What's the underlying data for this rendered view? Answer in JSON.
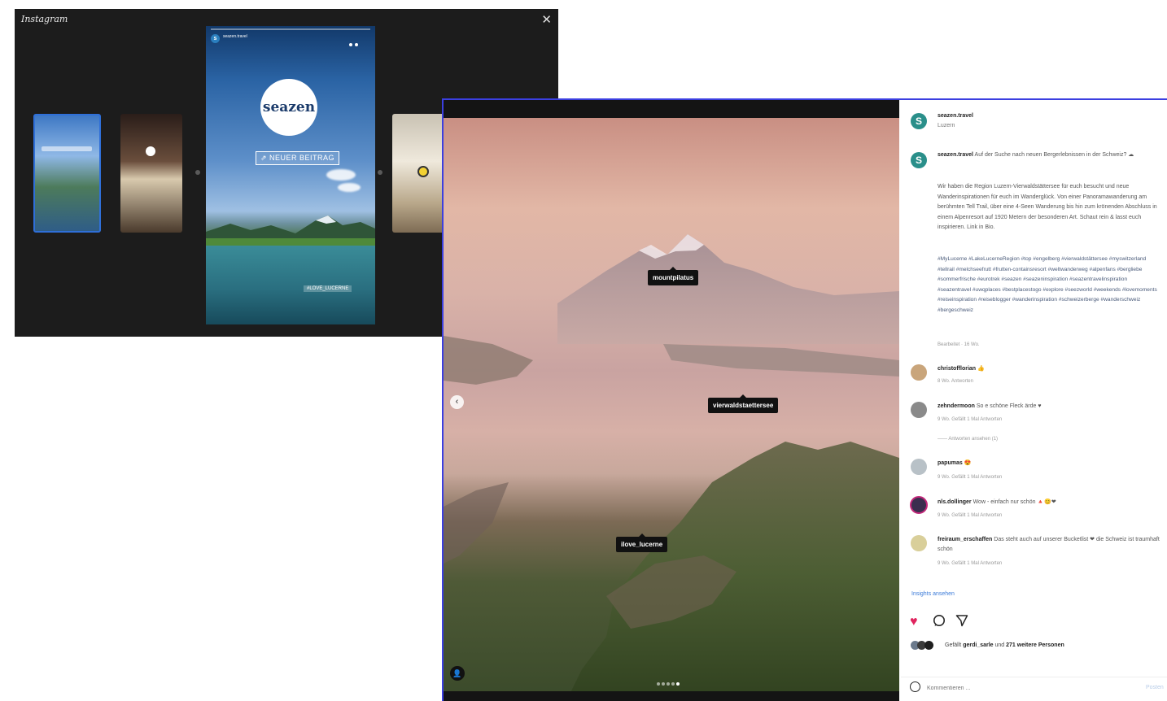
{
  "stories": {
    "logo": "Instagram",
    "close_icon": "✕",
    "thumb2_title": "",
    "main": {
      "badge": "seazen",
      "new_post": "⇗ NEUER BEITRAG",
      "tag": "#LOVE_LUCERNE",
      "username": "seazen.travel",
      "subtitle": ""
    }
  },
  "post": {
    "labels": {
      "pilatus": "mountpilatus",
      "lake": "vierwaldstaettersee",
      "lucerne": "ilove_lucerne"
    },
    "header": {
      "username": "seazen.travel",
      "location": "Luzern",
      "logo": "S"
    },
    "caption": {
      "username": "seazen.travel",
      "lead": "Auf der Suche nach neuen Bergerlebnissen in der Schweiz? ☁",
      "body": "Wir haben die Region Luzern-Vierwaldstättersee für euch besucht und neue Wanderinspirationen für euch im Wanderglück. Von einer Panoramawanderung am berühmten Tell Trail, über eine 4-Seen Wanderung bis hin zum krönenden Abschluss in einem Alpenresort auf 1920 Metern der besonderen Art. Schaut rein & lasst euch inspirieren. Link in Bio.",
      "hashtags": "#MyLucerne #LakeLucerneRegion #top #engelberg #vierwaldstättersee #myswitzerland #tellrail #melchseefrutt #frutten-containsresort #weltwanderweg #alpenfans #bergliebe #sommerfrische #eurotrek #seazen #seazeninspiration #seazentravelinspiration #seazentravel #uwqplaces #bestplacestogo #explore #seezworld #weekends #lovemoments #reiseinspiration #reiseblogger #wanderinspiration #schweizerberge #wanderschweiz #bergeschweiz",
      "meta": "Bearbeitet · 16 Wo."
    },
    "comments": [
      {
        "username": "christofflorian",
        "text": "👍",
        "meta": "8 Wo.   Antworten"
      },
      {
        "username": "zehndermoon",
        "text": "So e schöne Fleck ärde ♥",
        "meta": "9 Wo.   Gefällt 1 Mal   Antworten",
        "replies": "—— Antworten ansehen (1)"
      },
      {
        "username": "papumas",
        "text": "😍",
        "meta": "9 Wo.   Gefällt 1 Mal   Antworten"
      },
      {
        "username": "nls.dollinger",
        "text": "Wow - einfach nur schön 🔺😊❤",
        "meta": "9 Wo.   Gefällt 1 Mal   Antworten"
      },
      {
        "username": "freiraum_erschaffen",
        "text": "Das steht auch auf unserer Bucketlist ❤ die Schweiz ist traumhaft schön",
        "meta": "9 Wo.   Gefällt 1 Mal   Antworten"
      }
    ],
    "insights": "Insights ansehen",
    "likes_prefix": "Gefällt",
    "likes_user": "gerdi_sarle",
    "likes_mid": "und",
    "likes_others": "271 weitere Personen",
    "date": "",
    "comment_placeholder": "Kommentieren ...",
    "post_button": "Posten",
    "icons": {
      "heart": "heart-icon",
      "comment": "comment-icon",
      "share": "share-icon"
    },
    "colors": {
      "heart": "#e0245e",
      "accent": "#3b7bd8",
      "brand": "#2a8f8a"
    }
  }
}
